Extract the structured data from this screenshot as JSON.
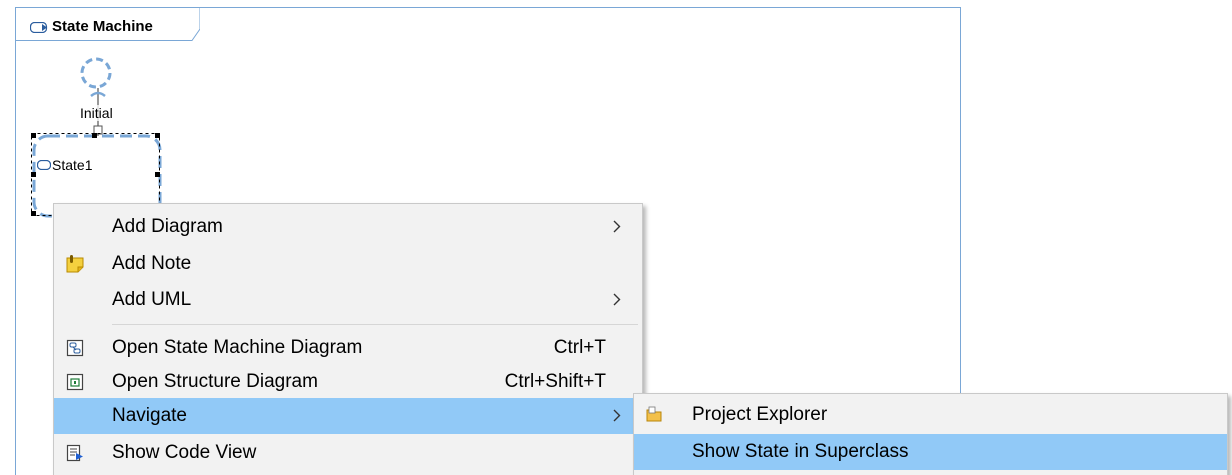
{
  "diagram": {
    "frame_title": "State Machine",
    "initial_label": "Initial",
    "state_label": "State1"
  },
  "colors": {
    "frame_border": "#7aa7d6",
    "node_dash": "#7aa7d6",
    "menu_background": "#f2f2f2",
    "menu_highlight": "#91c9f7"
  },
  "context_menu": {
    "items": [
      {
        "label": "Add Diagram",
        "icon": "",
        "shortcut": "",
        "submenu": true,
        "highlighted": false
      },
      {
        "label": "Add Note",
        "icon": "note-icon",
        "shortcut": "",
        "submenu": false,
        "highlighted": false
      },
      {
        "label": "Add UML",
        "icon": "",
        "shortcut": "",
        "submenu": true,
        "highlighted": false
      },
      {
        "label": "Open State Machine Diagram",
        "icon": "state-machine-diagram-icon",
        "shortcut": "Ctrl+T",
        "submenu": false,
        "highlighted": false
      },
      {
        "label": "Open Structure Diagram",
        "icon": "structure-diagram-icon",
        "shortcut": "Ctrl+Shift+T",
        "submenu": false,
        "highlighted": false
      },
      {
        "label": "Navigate",
        "icon": "",
        "shortcut": "",
        "submenu": true,
        "highlighted": true
      },
      {
        "label": "Show Code View",
        "icon": "code-view-icon",
        "shortcut": "",
        "submenu": false,
        "highlighted": false
      }
    ]
  },
  "navigate_submenu": {
    "items": [
      {
        "label": "Project Explorer",
        "icon": "project-explorer-icon",
        "highlighted": false
      },
      {
        "label": "Show State in Superclass",
        "icon": "",
        "highlighted": true
      }
    ]
  }
}
